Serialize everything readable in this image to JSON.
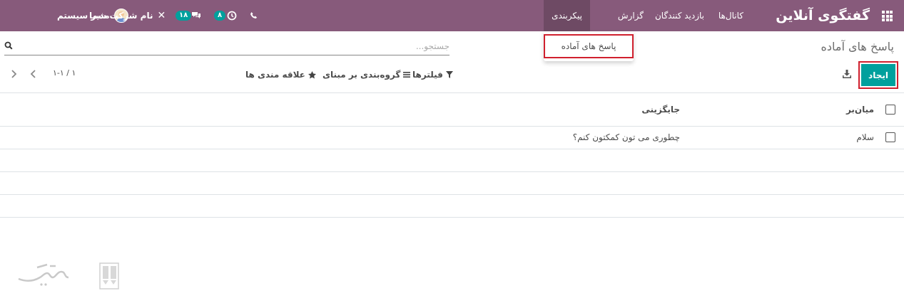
{
  "navbar": {
    "brand": "گفتگوی آنلاین",
    "menus": {
      "channels": "کانال‌ها",
      "visitors": "بازدید کنندگان",
      "report": "گزارش",
      "configuration": "پیکربندی"
    },
    "user_name": "مدیر سیستم",
    "company_name": "نام شرکت شما",
    "chat_count": "۱۸",
    "activity_count": "۸",
    "icons": {
      "apps": "apps-grid-icon",
      "chat": "chat-bubbles-icon",
      "activity": "clock-icon",
      "phone": "phone-icon",
      "close": "close-icon"
    }
  },
  "dropdown": {
    "item": "پاسخ های آماده"
  },
  "page": {
    "title": "پاسخ های آماده"
  },
  "search": {
    "placeholder": "جستجو..."
  },
  "toolbar": {
    "create_label": "ایجاد",
    "filters_label": "فیلترها",
    "groupby_label": "گروه‌بندی بر مبنای",
    "favorites_label": "علاقه مندی ها",
    "pager_value": "۱-۱ / ۱"
  },
  "table": {
    "columns": [
      "میان‌بر",
      "جایگزینی"
    ],
    "rows": [
      {
        "shortcut": "سلام",
        "substitution": "چطوری می تون کمکتون کنم؟"
      }
    ]
  },
  "colors": {
    "navbar": "#875a7b",
    "navbar_active": "#6e4a64",
    "primary": "#00a09d",
    "highlight": "#d0202e"
  }
}
